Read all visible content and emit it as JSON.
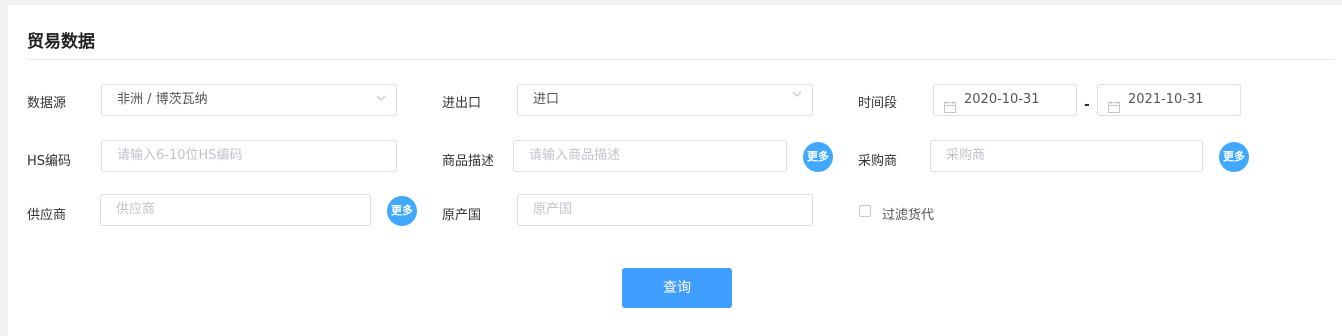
{
  "title": "贸易数据",
  "row1": {
    "source_label": "数据源",
    "source_value": "非洲 / 博茨瓦纳",
    "io_label": "进出口",
    "io_value": "进口",
    "period_label": "时间段",
    "date_start": "2020-10-31",
    "date_sep": "-",
    "date_end": "2021-10-31"
  },
  "row2": {
    "hs_label": "HS编码",
    "hs_placeholder": "请输入6-10位HS编码",
    "goods_label": "商品描述",
    "goods_placeholder": "请输入商品描述",
    "buyer_label": "采购商",
    "buyer_placeholder": "采购商"
  },
  "row3": {
    "supplier_label": "供应商",
    "supplier_placeholder": "供应商",
    "origin_label": "原产国",
    "origin_placeholder": "原产国",
    "filter_label": "过滤货代",
    "filter_checked": false
  },
  "more_label": "更多",
  "query_label": "查询",
  "colors": {
    "primary": "#409eff",
    "more_badge": "#40a9ff",
    "placeholder": "#c0c4cc",
    "border": "#dcdfe6"
  },
  "icons": {
    "dropdown": "chevron-down-icon",
    "date": "calendar-icon",
    "checkbox": "checkbox-icon"
  }
}
